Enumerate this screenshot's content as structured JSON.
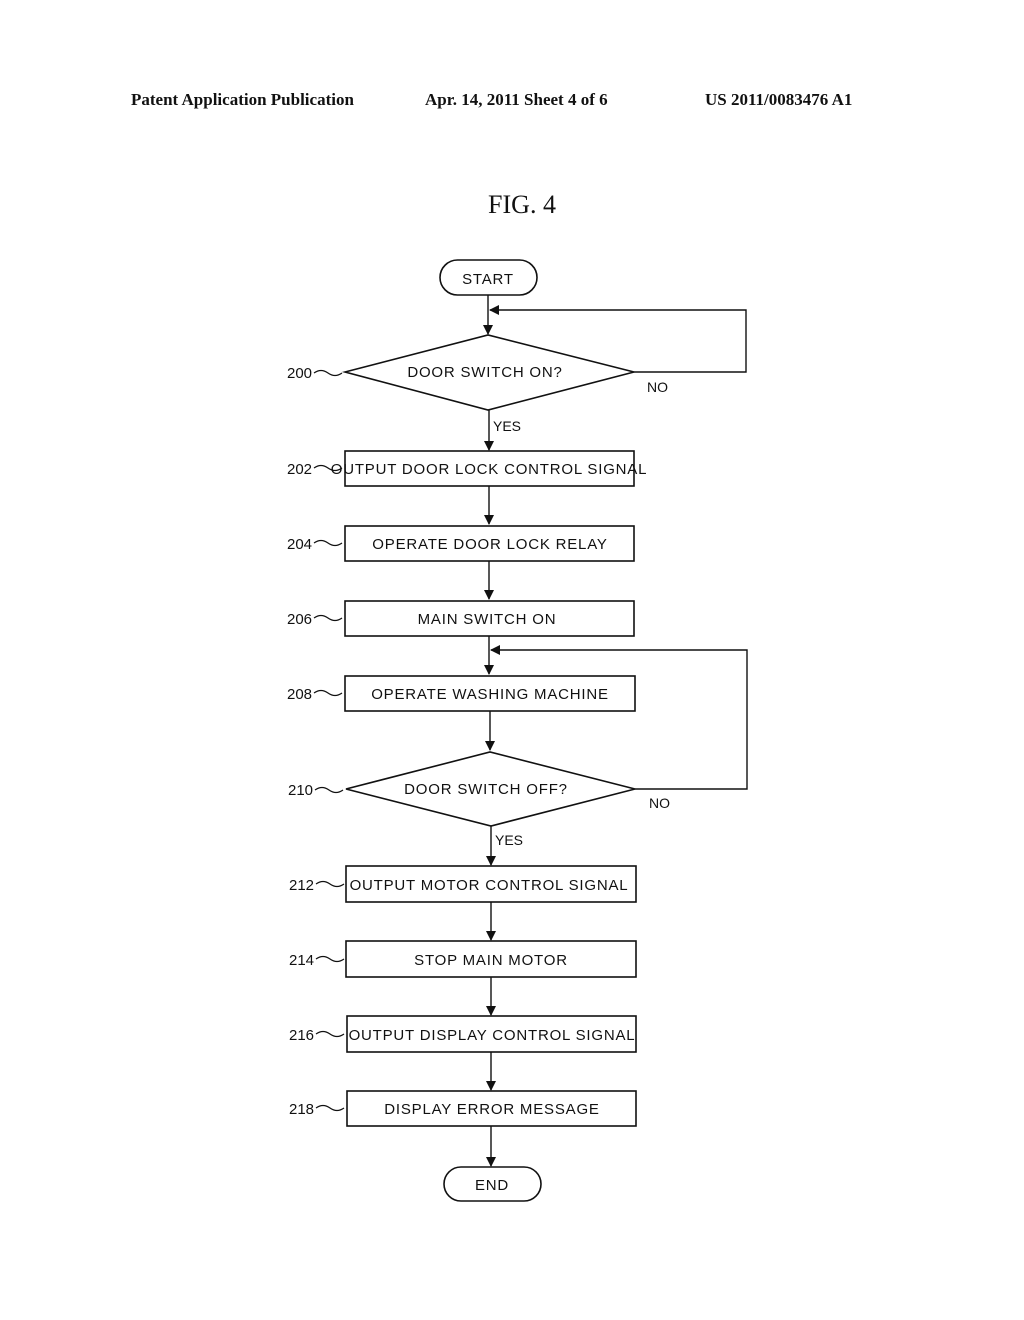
{
  "header": {
    "publication": "Patent Application Publication",
    "date_sheet": "Apr. 14, 2011  Sheet 4 of 6",
    "number": "US 2011/0083476 A1"
  },
  "figure": {
    "title": "FIG. 4",
    "start": "START",
    "end": "END",
    "steps": [
      {
        "ref": "200",
        "type": "decision",
        "text": "DOOR SWITCH ON?",
        "yes": "YES",
        "no": "NO"
      },
      {
        "ref": "202",
        "type": "process",
        "text": "OUTPUT DOOR LOCK CONTROL SIGNAL"
      },
      {
        "ref": "204",
        "type": "process",
        "text": "OPERATE DOOR LOCK RELAY"
      },
      {
        "ref": "206",
        "type": "process",
        "text": "MAIN SWITCH ON"
      },
      {
        "ref": "208",
        "type": "process",
        "text": "OPERATE WASHING MACHINE"
      },
      {
        "ref": "210",
        "type": "decision",
        "text": "DOOR SWITCH OFF?",
        "yes": "YES",
        "no": "NO"
      },
      {
        "ref": "212",
        "type": "process",
        "text": "OUTPUT MOTOR CONTROL SIGNAL"
      },
      {
        "ref": "214",
        "type": "process",
        "text": "STOP MAIN MOTOR"
      },
      {
        "ref": "216",
        "type": "process",
        "text": "OUTPUT DISPLAY CONTROL SIGNAL"
      },
      {
        "ref": "218",
        "type": "process",
        "text": "DISPLAY ERROR MESSAGE"
      }
    ]
  }
}
